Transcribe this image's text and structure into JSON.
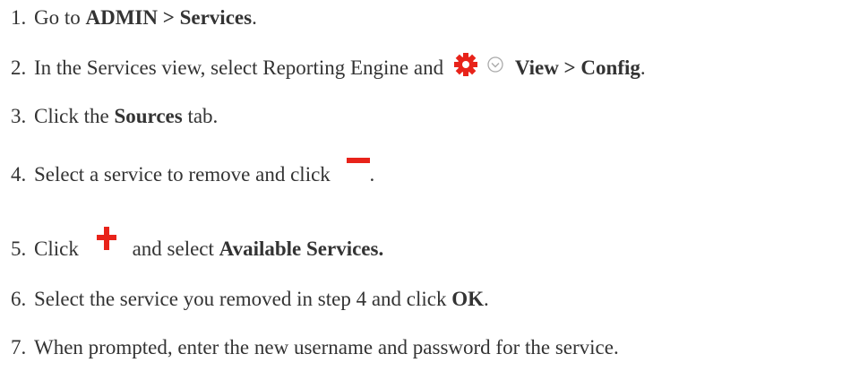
{
  "steps": [
    {
      "num": "1.",
      "pre": "Go to ",
      "bold": "ADMIN > Services",
      "post": "."
    },
    {
      "num": "2.",
      "pre": "In the Services view, select Reporting Engine and ",
      "bold": "View > Config",
      "post": "."
    },
    {
      "num": "3.",
      "pre": "Click the ",
      "bold": "Sources",
      "post": " tab."
    },
    {
      "num": "4.",
      "pre": "Select a service to remove and click ",
      "post": "."
    },
    {
      "num": "5.",
      "pre": "Click ",
      "mid": "and select ",
      "bold": "Available Services."
    },
    {
      "num": "6.",
      "pre": "Select the service you removed in step 4 and click ",
      "bold": "OK",
      "post": "."
    },
    {
      "num": "7.",
      "pre": "When prompted, enter the new username and password for the service."
    }
  ],
  "icons": {
    "gear": "gear-icon",
    "chevron": "chevron-down-icon",
    "remove": "minus-icon",
    "add": "plus-icon"
  },
  "colors": {
    "text": "#333333",
    "gear": "#e8231a",
    "remove": "#e8231a",
    "add": "#e8231a",
    "chevron": "#aaaaaa"
  }
}
